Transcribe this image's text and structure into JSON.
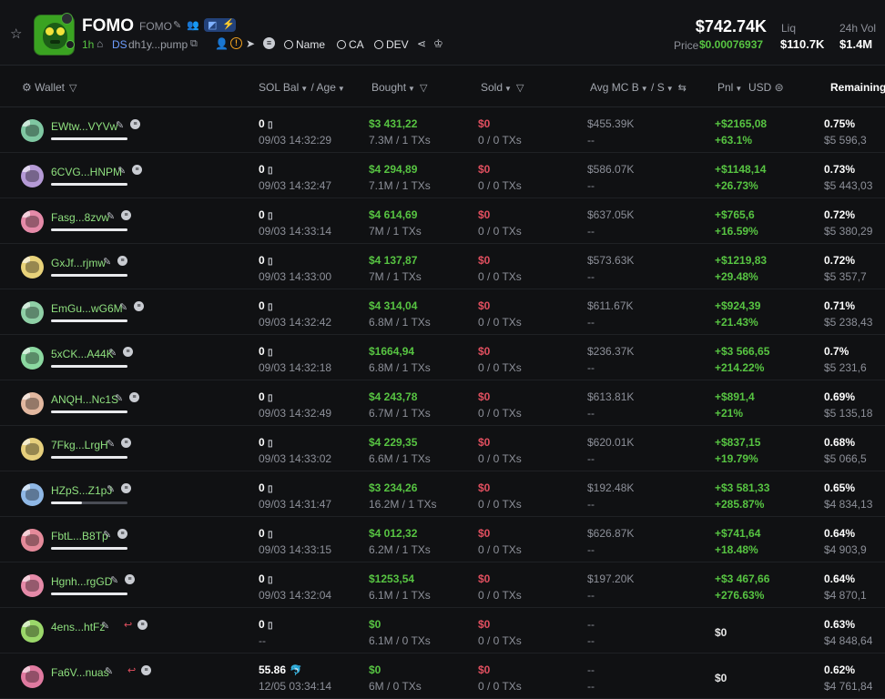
{
  "header": {
    "token_name": "FOMO",
    "token_symbol": "FOMO",
    "age": "1h",
    "ds_label": "DS",
    "address": "dh1y...pump",
    "warn_glyph": "!",
    "menu_glyph": "≡",
    "search_links": [
      "Name",
      "CA",
      "DEV"
    ],
    "market_cap": "$742.74K",
    "price_label": "Price",
    "price_value": "$0.00076937",
    "liq_label": "Liq",
    "liq_value": "$110.7K",
    "vol_label": "24h Vol",
    "vol_value": "$1.4M",
    "icons": [
      "star-icon",
      "edit-icon",
      "people-icon",
      "twitter-icon",
      "bolt-icon",
      "home-icon",
      "copy-icon",
      "person-icon",
      "warning-icon",
      "telegram-icon",
      "menu-icon",
      "search-icon",
      "share-icon",
      "crown-icon"
    ]
  },
  "columns": {
    "wallet": "Wallet",
    "sol_bal": "SOL Bal",
    "age": "Age",
    "bought": "Bought",
    "sold": "Sold",
    "avg_mc": "Avg MC B",
    "avg_s": "S",
    "pnl": "Pnl",
    "usd": "USD",
    "remaining": "Remaining%"
  },
  "colors": {
    "green": "#57c442",
    "red": "#e04f5f",
    "muted": "#8d9099",
    "background": "#101113"
  },
  "rows": [
    {
      "wallet": "EWtw...VYVw",
      "sol": "0",
      "time": "09/03 14:32:29",
      "bought": "$3 431,22",
      "bought_tx": "7.3M / 1 TXs",
      "sold": "$0",
      "sold_tx": "0 / 0 TXs",
      "avg_mc": "$455.39K",
      "avg_sell": "--",
      "pnl": "+$2165,08",
      "pnl_pct": "+63.1%",
      "rem_pct": "0.75%",
      "rem_usd": "$5 596,3",
      "avatar_color": "#7fc8a2",
      "bar": 1.0,
      "sell_icon": false
    },
    {
      "wallet": "6CVG...HNPM",
      "sol": "0",
      "time": "09/03 14:32:47",
      "bought": "$4 294,89",
      "bought_tx": "7.1M / 1 TXs",
      "sold": "$0",
      "sold_tx": "0 / 0 TXs",
      "avg_mc": "$586.07K",
      "avg_sell": "--",
      "pnl": "+$1148,14",
      "pnl_pct": "+26.73%",
      "rem_pct": "0.73%",
      "rem_usd": "$5 443,03",
      "avatar_color": "#b59ad6",
      "bar": 1.0,
      "sell_icon": false
    },
    {
      "wallet": "Fasg...8zvw",
      "sol": "0",
      "time": "09/03 14:33:14",
      "bought": "$4 614,69",
      "bought_tx": "7M / 1 TXs",
      "sold": "$0",
      "sold_tx": "0 / 0 TXs",
      "avg_mc": "$637.05K",
      "avg_sell": "--",
      "pnl": "+$765,6",
      "pnl_pct": "+16.59%",
      "rem_pct": "0.72%",
      "rem_usd": "$5 380,29",
      "avatar_color": "#e58aa8",
      "bar": 1.0,
      "sell_icon": false
    },
    {
      "wallet": "GxJf...rjmw",
      "sol": "0",
      "time": "09/03 14:33:00",
      "bought": "$4 137,87",
      "bought_tx": "7M / 1 TXs",
      "sold": "$0",
      "sold_tx": "0 / 0 TXs",
      "avg_mc": "$573.63K",
      "avg_sell": "--",
      "pnl": "+$1219,83",
      "pnl_pct": "+29.48%",
      "rem_pct": "0.72%",
      "rem_usd": "$5 357,7",
      "avatar_color": "#e8d27a",
      "bar": 1.0,
      "sell_icon": false
    },
    {
      "wallet": "EmGu...wG6M",
      "sol": "0",
      "time": "09/03 14:32:42",
      "bought": "$4 314,04",
      "bought_tx": "6.8M / 1 TXs",
      "sold": "$0",
      "sold_tx": "0 / 0 TXs",
      "avg_mc": "$611.67K",
      "avg_sell": "--",
      "pnl": "+$924,39",
      "pnl_pct": "+21.43%",
      "rem_pct": "0.71%",
      "rem_usd": "$5 238,43",
      "avatar_color": "#8fd0a6",
      "bar": 1.0,
      "sell_icon": false
    },
    {
      "wallet": "5xCK...A44K",
      "sol": "0",
      "time": "09/03 14:32:18",
      "bought": "$1664,94",
      "bought_tx": "6.8M / 1 TXs",
      "sold": "$0",
      "sold_tx": "0 / 0 TXs",
      "avg_mc": "$236.37K",
      "avg_sell": "--",
      "pnl": "+$3 566,65",
      "pnl_pct": "+214.22%",
      "rem_pct": "0.7%",
      "rem_usd": "$5 231,6",
      "avatar_color": "#8bd8a0",
      "bar": 1.0,
      "sell_icon": false
    },
    {
      "wallet": "ANQH...Nc1S",
      "sol": "0",
      "time": "09/03 14:32:49",
      "bought": "$4 243,78",
      "bought_tx": "6.7M / 1 TXs",
      "sold": "$0",
      "sold_tx": "0 / 0 TXs",
      "avg_mc": "$613.81K",
      "avg_sell": "--",
      "pnl": "+$891,4",
      "pnl_pct": "+21%",
      "rem_pct": "0.69%",
      "rem_usd": "$5 135,18",
      "avatar_color": "#e3b8a0",
      "bar": 1.0,
      "sell_icon": false
    },
    {
      "wallet": "7Fkg...LrgH",
      "sol": "0",
      "time": "09/03 14:33:02",
      "bought": "$4 229,35",
      "bought_tx": "6.6M / 1 TXs",
      "sold": "$0",
      "sold_tx": "0 / 0 TXs",
      "avg_mc": "$620.01K",
      "avg_sell": "--",
      "pnl": "+$837,15",
      "pnl_pct": "+19.79%",
      "rem_pct": "0.68%",
      "rem_usd": "$5 066,5",
      "avatar_color": "#e6cf7c",
      "bar": 1.0,
      "sell_icon": false
    },
    {
      "wallet": "HZpS...Z1pJ",
      "sol": "0",
      "time": "09/03 14:31:47",
      "bought": "$3 234,26",
      "bought_tx": "16.2M / 1 TXs",
      "sold": "$0",
      "sold_tx": "0 / 0 TXs",
      "avg_mc": "$192.48K",
      "avg_sell": "--",
      "pnl": "+$3 581,33",
      "pnl_pct": "+285.87%",
      "rem_pct": "0.65%",
      "rem_usd": "$4 834,13",
      "avatar_color": "#8fb8e6",
      "bar": 0.4,
      "sell_icon": false
    },
    {
      "wallet": "FbtL...B8Tp",
      "sol": "0",
      "time": "09/03 14:33:15",
      "bought": "$4 012,32",
      "bought_tx": "6.2M / 1 TXs",
      "sold": "$0",
      "sold_tx": "0 / 0 TXs",
      "avg_mc": "$626.87K",
      "avg_sell": "--",
      "pnl": "+$741,64",
      "pnl_pct": "+18.48%",
      "rem_pct": "0.64%",
      "rem_usd": "$4 903,9",
      "avatar_color": "#e58a9a",
      "bar": 1.0,
      "sell_icon": false
    },
    {
      "wallet": "Hgnh...rgGD",
      "sol": "0",
      "time": "09/03 14:32:04",
      "bought": "$1253,54",
      "bought_tx": "6.1M / 1 TXs",
      "sold": "$0",
      "sold_tx": "0 / 0 TXs",
      "avg_mc": "$197.20K",
      "avg_sell": "--",
      "pnl": "+$3 467,66",
      "pnl_pct": "+276.63%",
      "rem_pct": "0.64%",
      "rem_usd": "$4 870,1",
      "avatar_color": "#e58aa8",
      "bar": 1.0,
      "sell_icon": false
    },
    {
      "wallet": "4ens...htFz",
      "sol": "0",
      "time": "--",
      "bought": "$0",
      "bought_tx": "6.1M / 0 TXs",
      "sold": "$0",
      "sold_tx": "0 / 0 TXs",
      "avg_mc": "--",
      "avg_sell": "--",
      "pnl": "$0",
      "pnl_pct": "",
      "rem_pct": "0.63%",
      "rem_usd": "$4 848,64",
      "avatar_color": "#9bd86a",
      "bar": 0,
      "sell_icon": true
    },
    {
      "wallet": "Fa6V...nuas",
      "sol": "55.86",
      "time": "12/05 03:34:14",
      "bought": "$0",
      "bought_tx": "6M / 0 TXs",
      "sold": "$0",
      "sold_tx": "0 / 0 TXs",
      "avg_mc": "--",
      "avg_sell": "--",
      "pnl": "$0",
      "pnl_pct": "",
      "rem_pct": "0.62%",
      "rem_usd": "$4 761,84",
      "avatar_color": "#e07aa0",
      "bar": 0,
      "sell_icon": true,
      "whale": true
    }
  ]
}
